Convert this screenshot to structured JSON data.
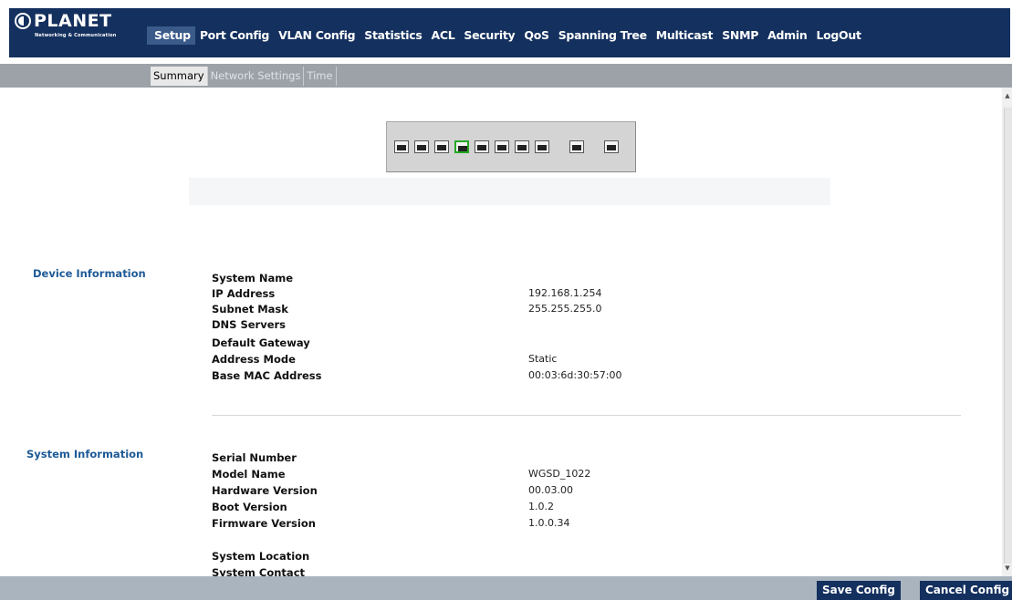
{
  "brand": {
    "name": "PLANET",
    "tagline": "Networking & Communication"
  },
  "nav": {
    "items": [
      {
        "label": "Setup",
        "active": true
      },
      {
        "label": "Port Config"
      },
      {
        "label": "VLAN Config"
      },
      {
        "label": "Statistics"
      },
      {
        "label": "ACL"
      },
      {
        "label": "Security"
      },
      {
        "label": "QoS"
      },
      {
        "label": "Spanning Tree"
      },
      {
        "label": "Multicast"
      },
      {
        "label": "SNMP"
      },
      {
        "label": "Admin"
      },
      {
        "label": "LogOut"
      }
    ]
  },
  "subnav": {
    "tabs": [
      {
        "label": "Summary",
        "active": true
      },
      {
        "label": "Network Settings"
      },
      {
        "label": "Time"
      }
    ]
  },
  "ports": {
    "count": 10,
    "active_port": 4,
    "active_color": "#22aa22"
  },
  "device_info": {
    "title": "Device Information",
    "fields": [
      {
        "label": "System Name",
        "value": ""
      },
      {
        "label": "IP Address",
        "value": "192.168.1.254"
      },
      {
        "label": "Subnet Mask",
        "value": "255.255.255.0"
      },
      {
        "label": "DNS Servers",
        "value": ""
      },
      {
        "label": "Default Gateway",
        "value": ""
      },
      {
        "label": "Address Mode",
        "value": "Static"
      },
      {
        "label": "Base MAC Address",
        "value": "00:03:6d:30:57:00"
      }
    ]
  },
  "system_info": {
    "title": "System Information",
    "fields": [
      {
        "label": "Serial Number",
        "value": ""
      },
      {
        "label": "Model Name",
        "value": "WGSD_1022"
      },
      {
        "label": "Hardware Version",
        "value": "00.03.00"
      },
      {
        "label": "Boot Version",
        "value": "1.0.2"
      },
      {
        "label": "Firmware Version",
        "value": "1.0.0.34"
      },
      {
        "label": "System Location",
        "value": ""
      },
      {
        "label": "System Contact",
        "value": ""
      }
    ]
  },
  "actions": {
    "save_label": "Save Config",
    "cancel_label": "Cancel Config"
  },
  "colors": {
    "header_bg": "#14305e",
    "section_label": "#1e5a96",
    "bottom_bar": "#a9b4bf"
  }
}
